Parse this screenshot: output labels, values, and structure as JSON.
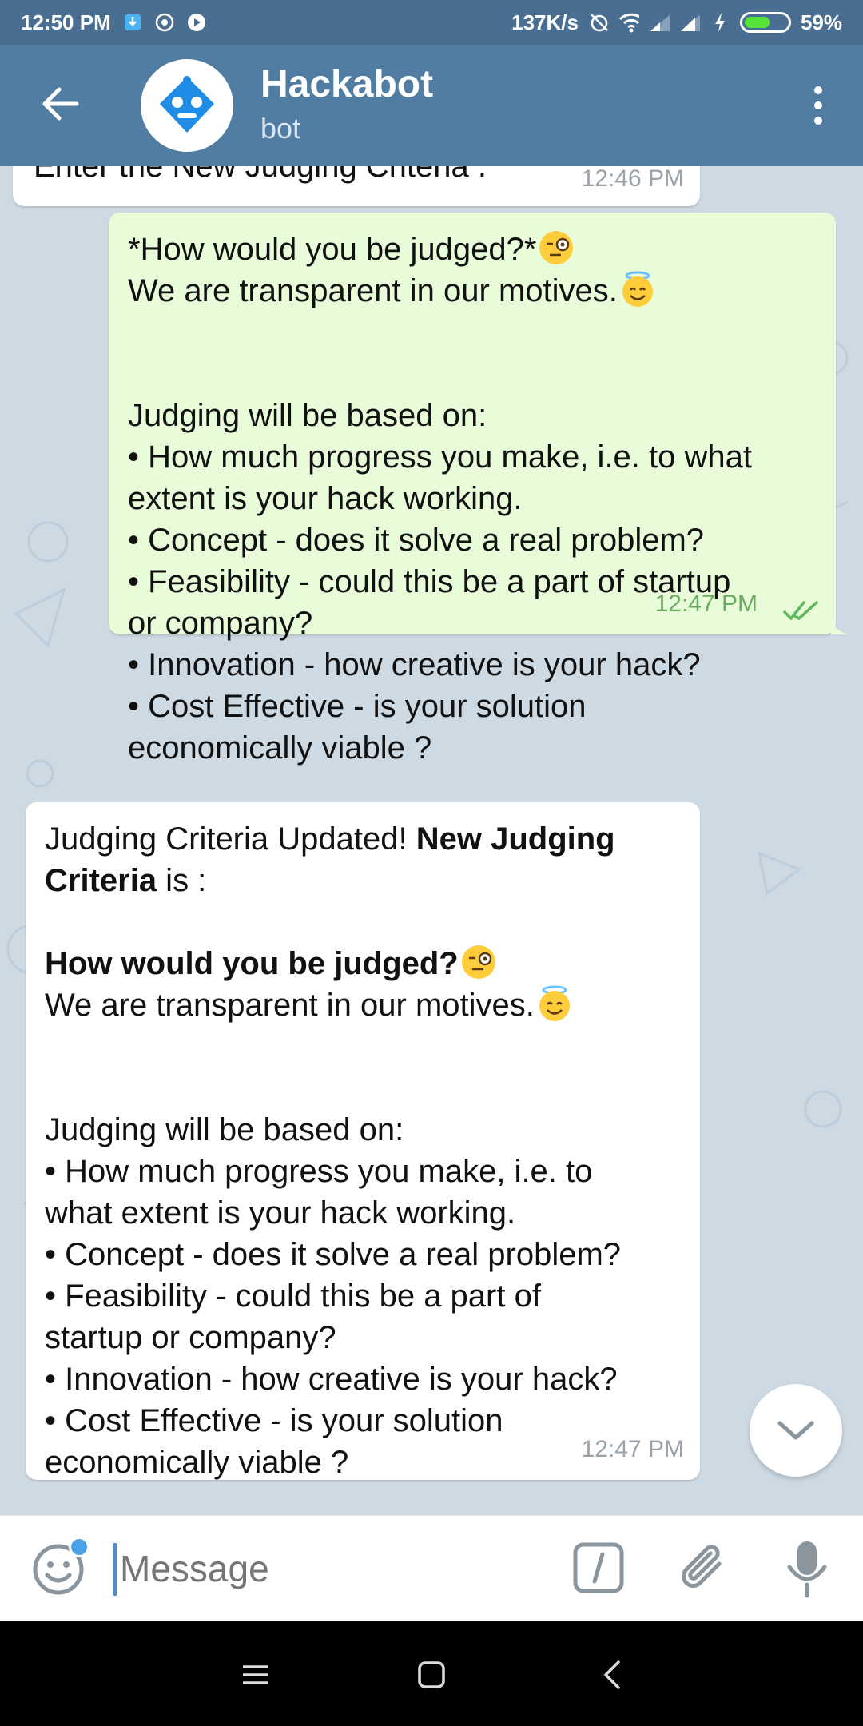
{
  "status": {
    "time": "12:50 PM",
    "speed": "137K/s",
    "battery": "59%",
    "battery_level": 0.59
  },
  "header": {
    "title": "Hackabot",
    "subtitle": "bot"
  },
  "messages": {
    "top_partial": {
      "text": "Enter the New Judging Criteria :",
      "time": "12:46 PM"
    },
    "outgoing": {
      "lines": [
        "*How would you be judged?*",
        "We are transparent in our motives.",
        "",
        "",
        "Judging will be based on:",
        "• How much progress you make, i.e. to what",
        "extent is your hack working.",
        "• Concept - does it solve a real problem?",
        "• Feasibility - could this be a part of startup",
        "or company?",
        "• Innovation - how creative is your hack?",
        "• Cost Effective - is your solution",
        "economically viable ?"
      ],
      "time": "12:47 PM"
    },
    "incoming": {
      "line1_a": "Judging Criteria Updated! ",
      "line1_b": "New Judging",
      "line2_a": "Criteria",
      "line2_b": " is :",
      "heading": "How would you be judged?",
      "motives": "We are transparent in our motives.",
      "lines": [
        "Judging will be based on:",
        "• How much progress you make, i.e. to",
        "what extent is your hack working.",
        "• Concept - does it solve a real problem?",
        "• Feasibility - could this be a part of",
        "startup or company?",
        "• Innovation - how creative is your hack?",
        "• Cost Effective - is your solution",
        "economically viable ?"
      ],
      "time": "12:47 PM"
    }
  },
  "input": {
    "placeholder": "Message"
  },
  "icons": {
    "back": "arrow-left-icon",
    "avatar": "robot-icon",
    "menu": "more-vertical-icon",
    "emoji": "smile-icon",
    "commands": "slash-command-icon",
    "attach": "paperclip-icon",
    "mic": "microphone-icon",
    "scroll": "chevron-down-icon"
  },
  "colors": {
    "header": "#517da2",
    "statusbar": "#4a6e92",
    "outgoing": "#e8fcd9",
    "incoming": "#ffffff",
    "accent": "#4aa3e8"
  }
}
